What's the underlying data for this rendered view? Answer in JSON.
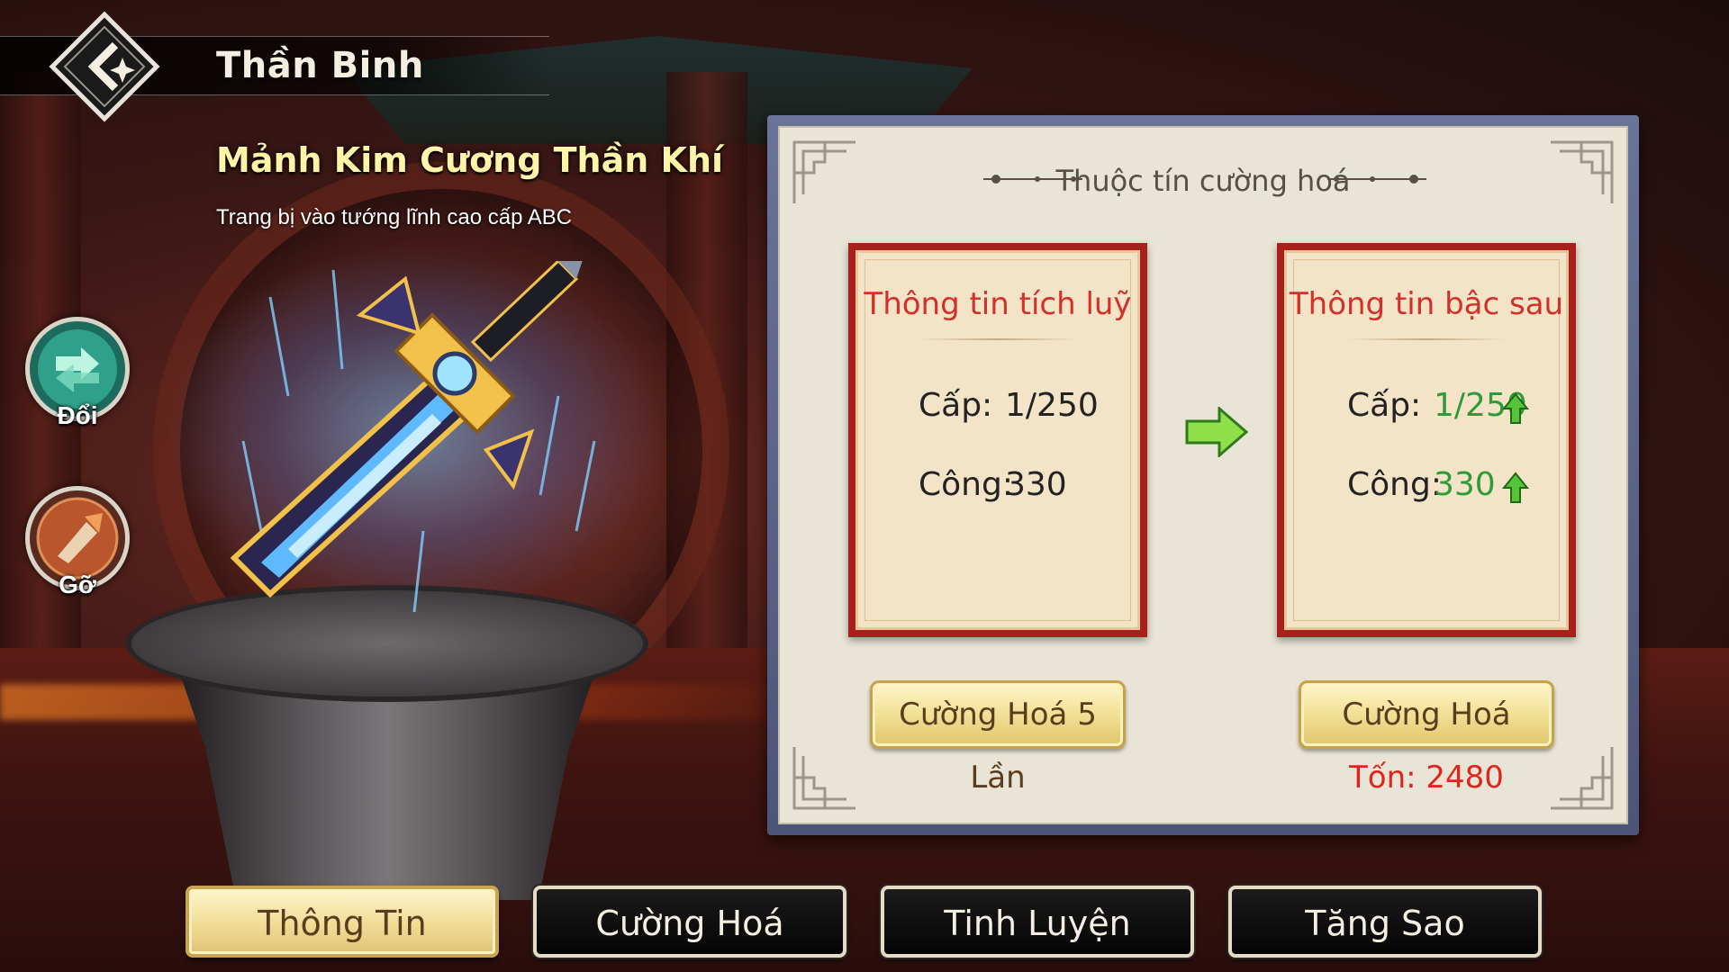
{
  "header": {
    "title": "Thần Binh"
  },
  "item": {
    "name": "Mảnh Kim Cương Thần Khí",
    "description": "Trang bị vào tướng lĩnh cao cấp ABC"
  },
  "side_buttons": {
    "swap_label": "Đổi",
    "remove_label": "Gỡ"
  },
  "panel": {
    "section_title": "Thuộc tín cường hoá",
    "current_card": {
      "title": "Thông tin tích luỹ",
      "level_label": "Cấp:",
      "level_value": "1/250",
      "attack_label": "Công:",
      "attack_value": "330"
    },
    "next_card": {
      "title": "Thông tin bậc sau",
      "level_label": "Cấp:",
      "level_value": "1/250",
      "attack_label": "Công:",
      "attack_value": "330"
    },
    "enhance_5_label": "Cường Hoá 5 Lần",
    "enhance_label": "Cường Hoá",
    "cost_text": "Tốn: 2480"
  },
  "tabs": [
    {
      "label": "Thông Tin",
      "active": true
    },
    {
      "label": "Cường Hoá",
      "active": false
    },
    {
      "label": "Tinh Luyện",
      "active": false
    },
    {
      "label": "Tăng Sao",
      "active": false
    }
  ],
  "colors": {
    "card_border": "#a8201b",
    "card_title": "#d4302a",
    "increase_green": "#2e9a3a",
    "cost_red": "#e0241e",
    "gold_button": "#f3e29a"
  }
}
